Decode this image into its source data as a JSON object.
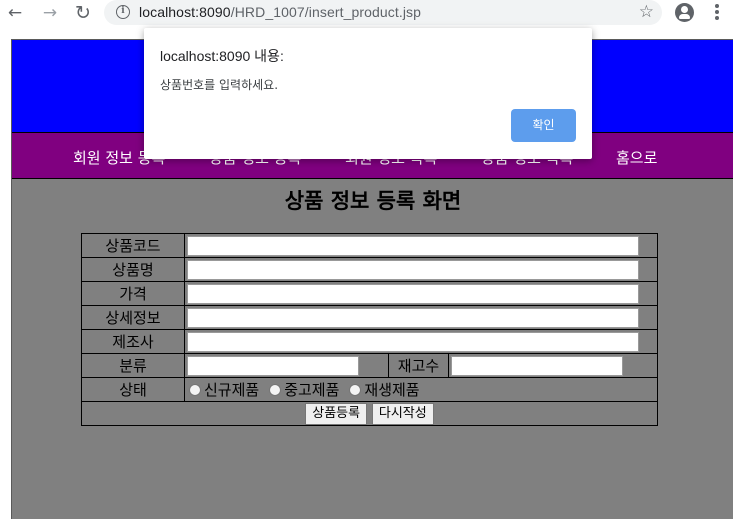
{
  "browser": {
    "url_host": "localhost:8090",
    "url_path": "/HRD_1007/insert_product.jsp",
    "icons": {
      "back": "←",
      "forward": "→",
      "reload": "↻",
      "info": "i",
      "bookmark": "☆"
    }
  },
  "nav": {
    "items": [
      "회원 정보 등록",
      "상품 정보 등록",
      "회원 정보 목록",
      "상품 정보 목록",
      "홈으로"
    ]
  },
  "main": {
    "title": "상품 정보 등록 화면",
    "form": {
      "labels": {
        "code": "상품코드",
        "name": "상품명",
        "price": "가격",
        "detail": "상세정보",
        "maker": "제조사",
        "category": "분류",
        "stock": "재고수",
        "status": "상태"
      },
      "values": {
        "code": "",
        "name": "",
        "price": "",
        "detail": "",
        "maker": "",
        "category": "",
        "stock": ""
      },
      "status_options": [
        "신규제품",
        "중고제품",
        "재생제품"
      ],
      "buttons": {
        "submit": "상품등록",
        "reset": "다시작성"
      }
    }
  },
  "dialog": {
    "title": "localhost:8090 내용:",
    "message": "상품번호를 입력하세요.",
    "ok_label": "확인"
  },
  "colors": {
    "header": "#0000ff",
    "nav": "#800080",
    "body": "#808080",
    "dialog_button": "#5d9ded"
  }
}
